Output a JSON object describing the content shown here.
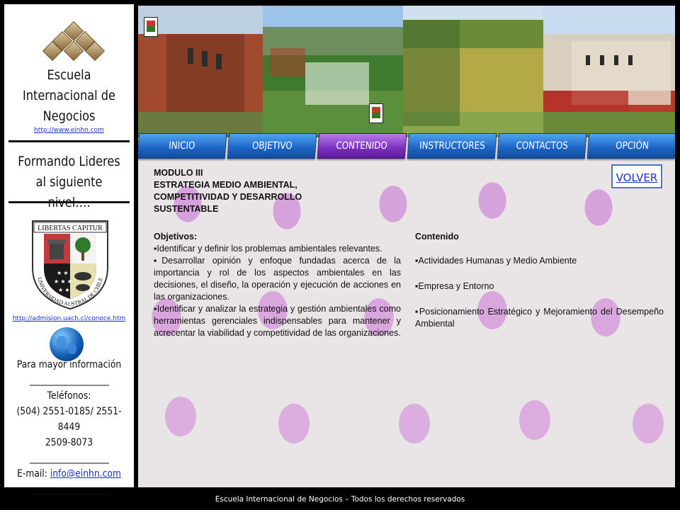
{
  "sidebar": {
    "school_name_line1": "Escuela",
    "school_name_line2": "Internacional de",
    "school_name_line3": "Negocios",
    "school_url": "http://www.einhn.com",
    "tagline_line1": "Formando Lideres",
    "tagline_line2": "al siguiente nivel….",
    "crest_motto": "LIBERTAS CAPITUR",
    "crest_ring_text": "UNIVERSIDAD AUSTRAL DE CHILE",
    "admission_url": "http://admision.uach.cl/conoce.htm",
    "info_label": "Para mayor información",
    "separator": "_____________________",
    "phones_label": "Teléfonos:",
    "phones_line1": "(504) 2551-0185/  2551-8449",
    "phones_line2": "2509-8073",
    "email_label": "E-mail: ",
    "email_value": "info@einhn.com"
  },
  "nav": {
    "items": [
      {
        "label": "INICIO"
      },
      {
        "label": "OBJETIVO"
      },
      {
        "label": "CONTENIDO"
      },
      {
        "label": "INSTRUCTORES"
      },
      {
        "label": "CONTACTOS"
      },
      {
        "label": "OPCIÓN"
      }
    ],
    "active": "CONTENIDO",
    "active_color": "#7a2fbf",
    "button_color": "#1c63c4"
  },
  "module": {
    "title_line1": "MODULO III",
    "title_line2": "ESTRATEGIA MEDIO AMBIENTAL,",
    "title_line3": "COMPETITIVIDAD Y DESARROLLO",
    "title_line4": "SUSTENTABLE",
    "objectives_heading": "Objetivos:",
    "objectives": [
      "▪Identificar y definir los problemas ambientales relevantes.",
      "▪Desarrollar opinión y enfoque fundadas acerca de la importancia y rol de los aspectos ambientales en las decisiones, el diseño, la operación y  ejecución de acciones  en las organizaciones.",
      "▪Identificar y analizar la estrategia y gestión ambientales como herramientas gerenciales indispensables para mantener y acrecentar la viabilidad y competitividad de las organizaciones."
    ],
    "content_heading": "Contenido",
    "content_items": [
      "▪Actividades Humanas y Medio Ambiente",
      "▪Empresa y Entorno",
      "▪Posicionamiento  Estratégico y Mejoramiento del Desempeño Ambiental"
    ]
  },
  "volver_label": "VOLVER",
  "footer_text": "Escuela Internacional de Negocios – Todos los derechos reservados"
}
